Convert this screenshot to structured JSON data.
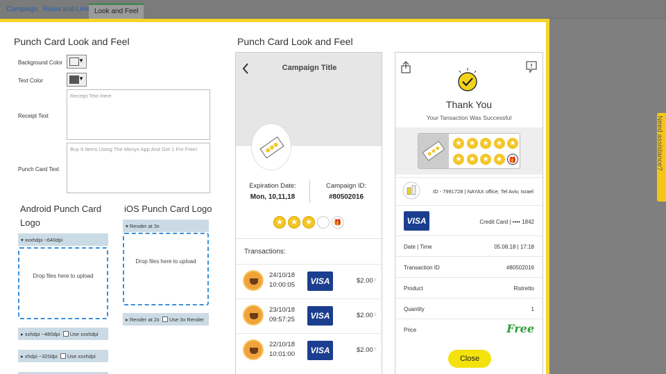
{
  "tabs": [
    {
      "label": "Campaign"
    },
    {
      "label": "Rules and Limits"
    },
    {
      "label": "Look and Feel"
    }
  ],
  "side_tab": {
    "label": "Need assistance?"
  },
  "form": {
    "title": "Punch Card Look and Feel",
    "background_color_label": "Background Color",
    "text_color_label": "Text Color",
    "receipt_text_label": "Receipt Text",
    "receipt_text_placeholder": "Receipt Text Here",
    "punch_card_text_label": "Punch Card Text",
    "punch_card_text_placeholder": "Buy 9 Items Using The Monyx App And Get 1 For Free!",
    "android_logo_title": "Android Punch Card Logo",
    "ios_logo_title": "iOS Punch Card Logo",
    "android_render_label": "xxxhdpi ~640dpi",
    "ios_render_label": "Render at 3x",
    "drop_text": "Drop files here to upload",
    "android_more": [
      {
        "label": "xxhdpi ~480dpi",
        "check_label": "Use xxxhdpi"
      },
      {
        "label": "xhdpi ~320dpi",
        "check_label": "Use xxxhdpi"
      }
    ],
    "ios_more": {
      "label": "Render at 2x",
      "check_label": "Use 3x Render"
    }
  },
  "preview": {
    "title": "Punch Card Look and Feel",
    "phone": {
      "back_icon": "chevron-left-icon",
      "header_title": "Campaign Title",
      "expiration_label": "Expiration Date:",
      "expiration_value": "Mon, 10,11,18",
      "campaign_id_label": "Campaign ID:",
      "campaign_id_value": "#80502016",
      "punches_filled": 3,
      "punches_total": 5,
      "transactions_label": "Transactions:",
      "transactions": [
        {
          "date": "24/10/18",
          "time": "10:00:05",
          "card": "VISA",
          "amount": "$2.00"
        },
        {
          "date": "23/10/18",
          "time": "09:57:25",
          "card": "VISA",
          "amount": "$2.00"
        },
        {
          "date": "22/10/18",
          "time": "10:01:00",
          "card": "VISA",
          "amount": "$2.00"
        }
      ]
    },
    "receipt": {
      "share_icon": "share-icon",
      "report_icon": "report-icon",
      "thank_you": "Thank You",
      "subtitle": "Your Tansaction Was Successful",
      "stamps_total": 10,
      "merchant": "ID - 7991728 | NAYAX office, Tel Aviv, Israel",
      "card_label": "VISA",
      "card_info": "Credit Card | •••• 1842",
      "rows": [
        {
          "k": "Date | Time",
          "v": "05.08.18 | 17:18"
        },
        {
          "k": "Transaction ID",
          "v": "#80502016"
        },
        {
          "k": "Product",
          "v": "Ristretto"
        },
        {
          "k": "Quantity",
          "v": "1"
        },
        {
          "k": "Price",
          "v": "Free"
        }
      ],
      "close_label": "Close"
    }
  },
  "colors": {
    "accent": "#f6d32a",
    "visa": "#1b3e8f",
    "free": "#2f9e3a",
    "stamp": "#f3c628"
  }
}
